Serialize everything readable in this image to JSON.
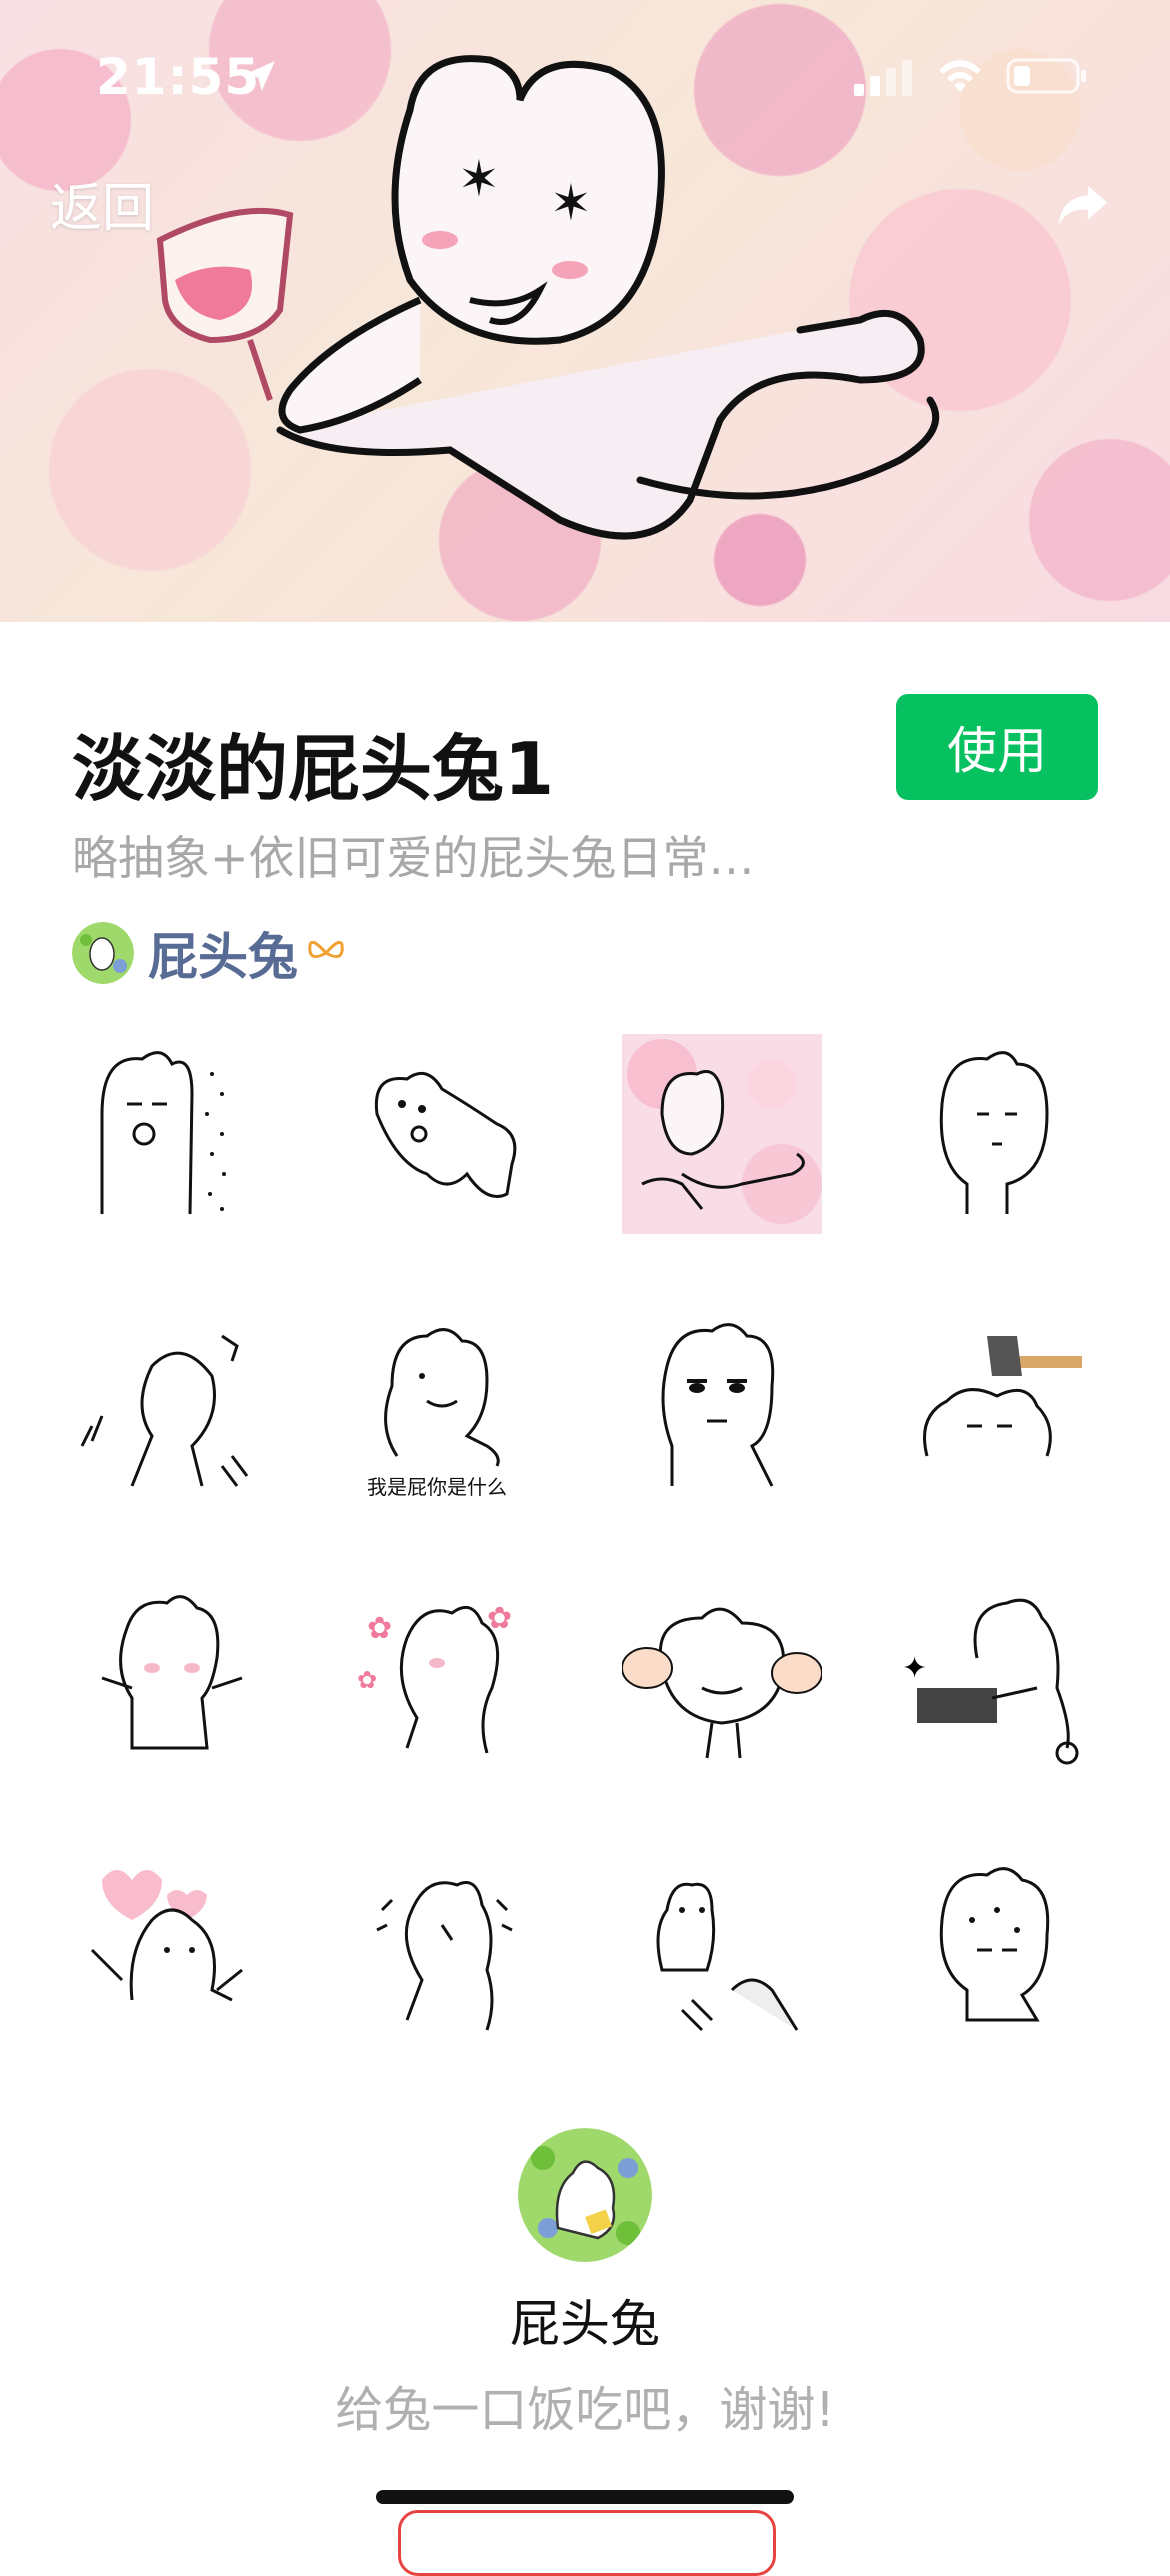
{
  "status_bar": {
    "time": "21:55"
  },
  "nav": {
    "back_label": "返回"
  },
  "pack": {
    "title": "淡淡的屁头兔1",
    "use_label": "使用",
    "description": "略抽象+依旧可爱的屁头兔日常…",
    "author": "屁头兔"
  },
  "stickers": [
    {
      "name": "sticker-1"
    },
    {
      "name": "sticker-2"
    },
    {
      "name": "sticker-3"
    },
    {
      "name": "sticker-4"
    },
    {
      "name": "sticker-5"
    },
    {
      "name": "sticker-6",
      "caption": "我是屁你是什么"
    },
    {
      "name": "sticker-7"
    },
    {
      "name": "sticker-8"
    },
    {
      "name": "sticker-9"
    },
    {
      "name": "sticker-10"
    },
    {
      "name": "sticker-11"
    },
    {
      "name": "sticker-12"
    },
    {
      "name": "sticker-13"
    },
    {
      "name": "sticker-14"
    },
    {
      "name": "sticker-15"
    },
    {
      "name": "sticker-16"
    }
  ],
  "footer": {
    "author_name": "屁头兔",
    "thanks": "给兔一口饭吃吧，谢谢!"
  },
  "colors": {
    "accent_green": "#07c160",
    "author_link": "#576b95",
    "muted_text": "#a8a8a8",
    "reward_red": "#e64340"
  },
  "icons": [
    "location-arrow-icon",
    "signal-icon",
    "wifi-icon",
    "battery-icon",
    "share-icon",
    "bow-icon"
  ]
}
